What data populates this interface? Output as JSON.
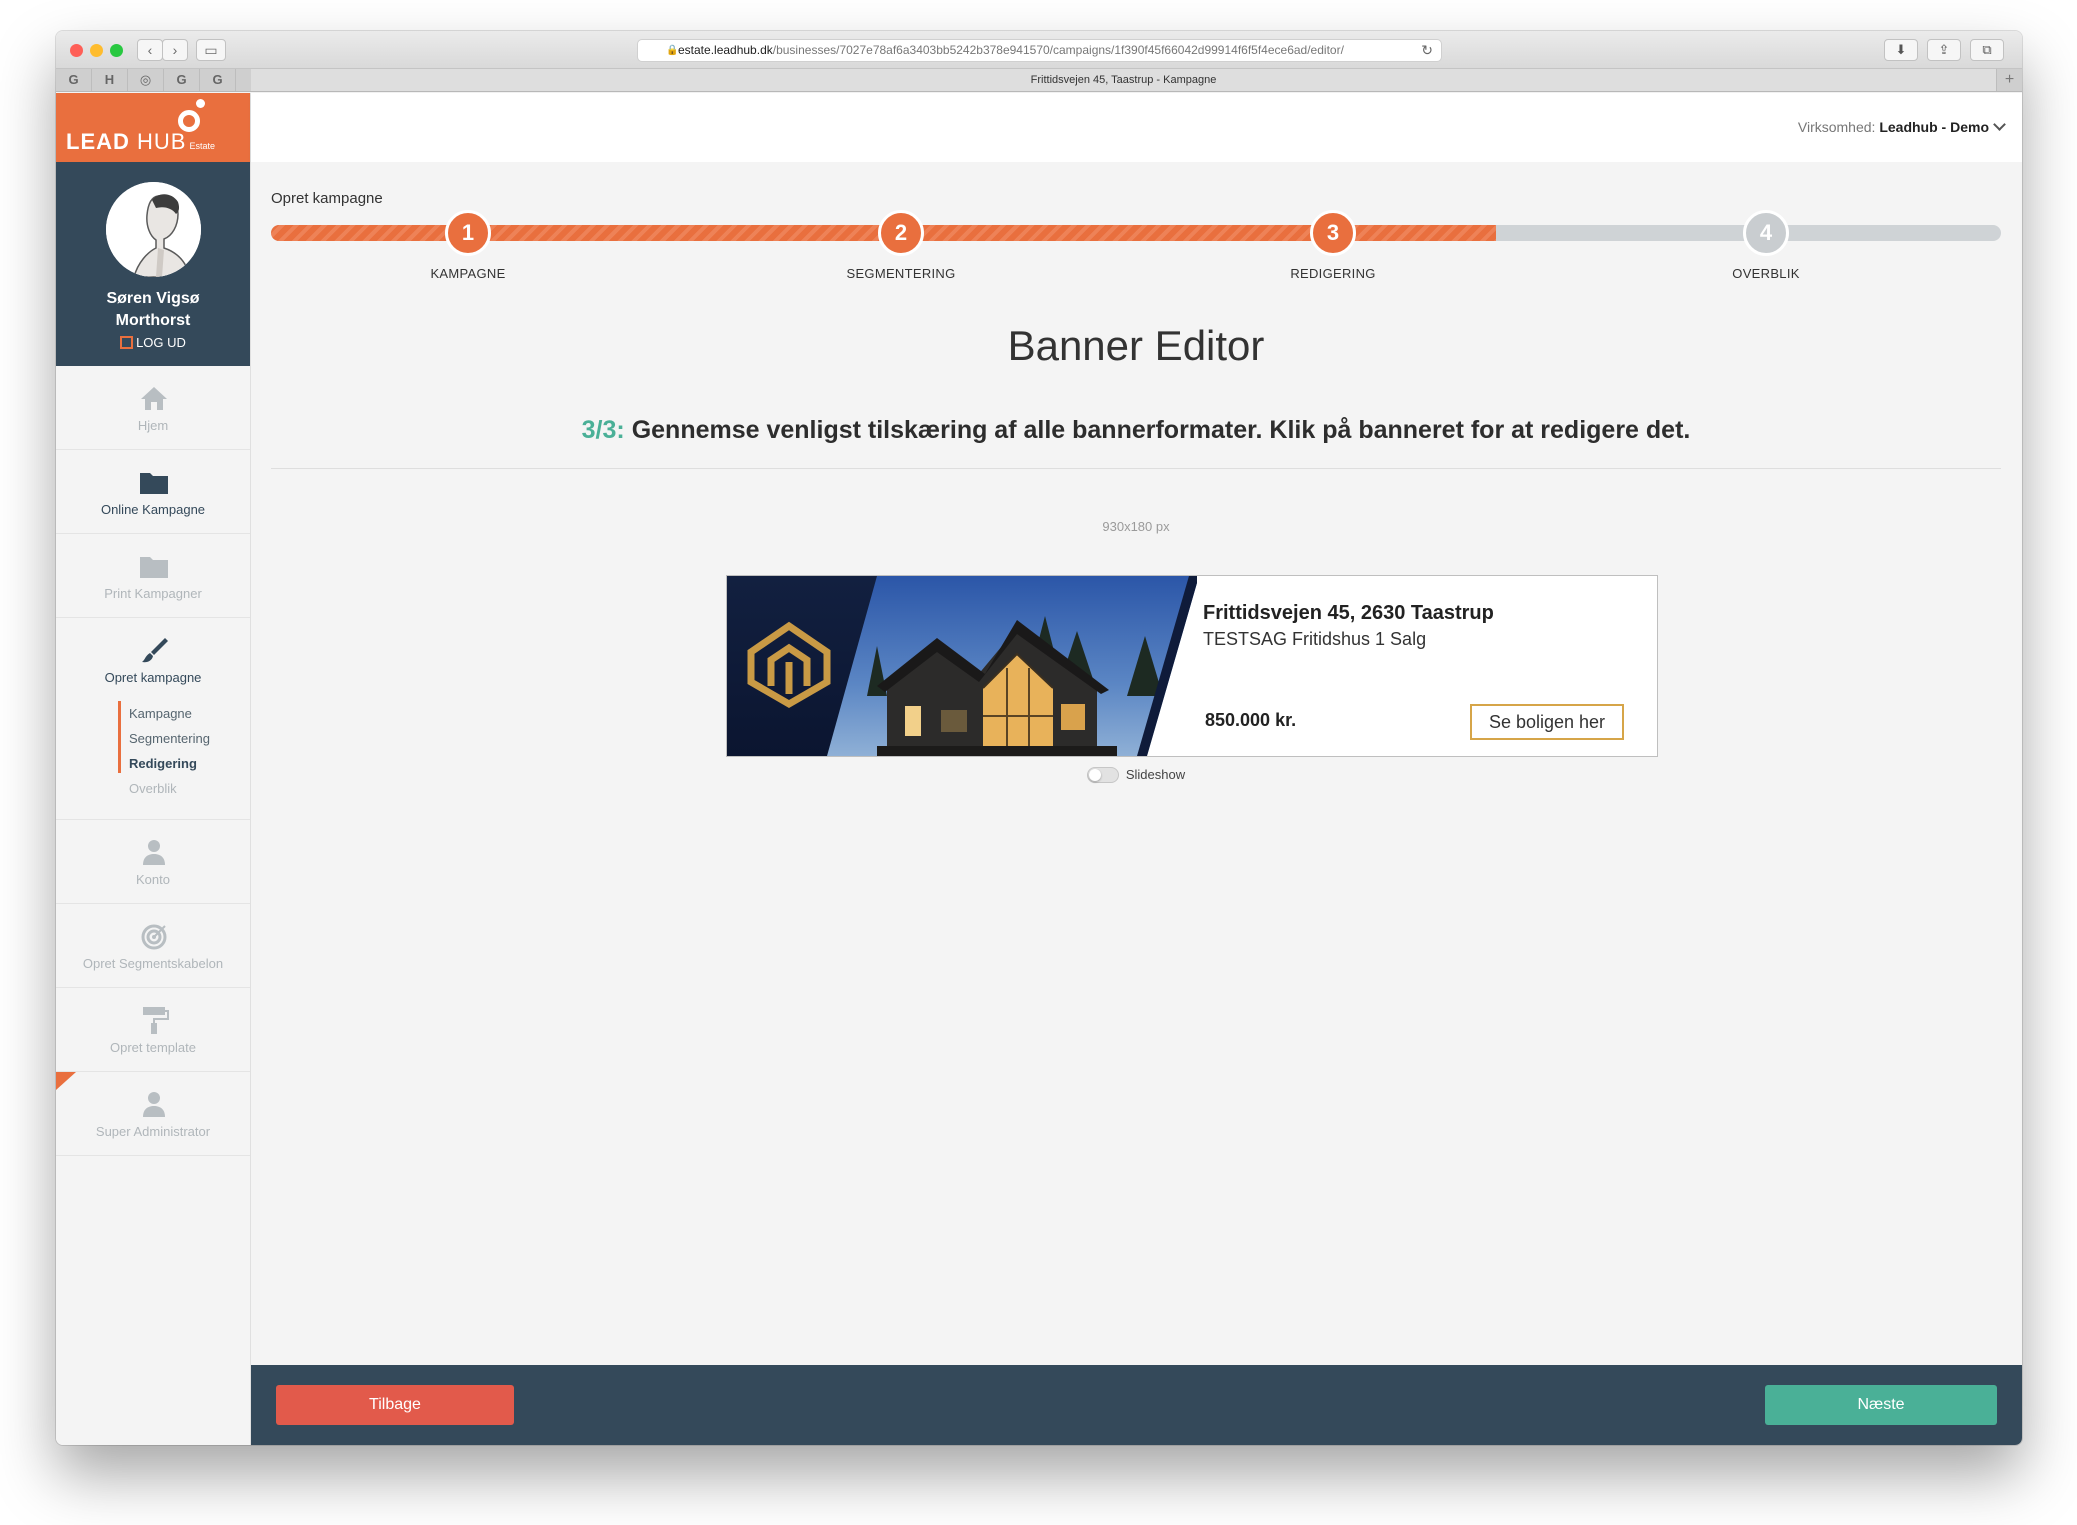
{
  "browser": {
    "url_host": "estate.leadhub.dk",
    "url_path": "/businesses/7027e78af6a3403bb5242b378e941570/campaigns/1f390f45f66042d99914f6f5f4ece6ad/editor/",
    "tab_title": "Frittidsvejen 45, Taastrup - Kampagne",
    "favorites": [
      "G",
      "H",
      "◎",
      "G",
      "G"
    ]
  },
  "logo": {
    "brand_bold": "LEAD",
    "brand_light": " HUB",
    "sub": "Estate"
  },
  "profile": {
    "name_line1": "Søren Vigsø",
    "name_line2": "Morthorst",
    "logout": "LOG UD"
  },
  "sidebar": {
    "items": [
      {
        "label": "Hjem",
        "icon": "home-icon"
      },
      {
        "label": "Online Kampagne",
        "icon": "folder-icon"
      },
      {
        "label": "Print Kampagner",
        "icon": "folder-icon"
      },
      {
        "label": "Opret kampagne",
        "icon": "brush-icon"
      },
      {
        "label": "Konto",
        "icon": "user-icon"
      },
      {
        "label": "Opret Segmentskabelon",
        "icon": "target-icon"
      },
      {
        "label": "Opret template",
        "icon": "paint-roller-icon"
      },
      {
        "label": "Super Administrator",
        "icon": "user-icon"
      }
    ],
    "subitems": [
      "Kampagne",
      "Segmentering",
      "Redigering",
      "Overblik"
    ]
  },
  "header": {
    "company_label": "Virksomhed:",
    "company_value": "Leadhub - Demo"
  },
  "wizard": {
    "label": "Opret kampagne",
    "progress_fraction": 0.708,
    "steps": [
      {
        "number": "1",
        "label": "KAMPAGNE",
        "state": "done"
      },
      {
        "number": "2",
        "label": "SEGMENTERING",
        "state": "done"
      },
      {
        "number": "3",
        "label": "REDIGERING",
        "state": "current"
      },
      {
        "number": "4",
        "label": "OVERBLIK",
        "state": "todo"
      }
    ]
  },
  "editor": {
    "title": "Banner Editor",
    "instruction_step": "3/3:",
    "instruction_text": " Gennemse venligst tilskæring af alle bannerformater. Klik på banneret for at redigere det.",
    "size_label": "930x180 px",
    "slideshow_label": "Slideshow"
  },
  "banner": {
    "title": "Frittidsvejen 45, 2630 Taastrup",
    "subtitle": "TESTSAG Fritidshus 1 Salg",
    "price": "850.000 kr.",
    "cta": "Se boligen her"
  },
  "footer": {
    "back_label": "Tilbage",
    "next_label": "Næste"
  },
  "colors": {
    "accent": "#e96f3e",
    "navy": "#34495a",
    "green": "#4ab097",
    "red": "#e25a4b",
    "gold": "#d6a548"
  }
}
